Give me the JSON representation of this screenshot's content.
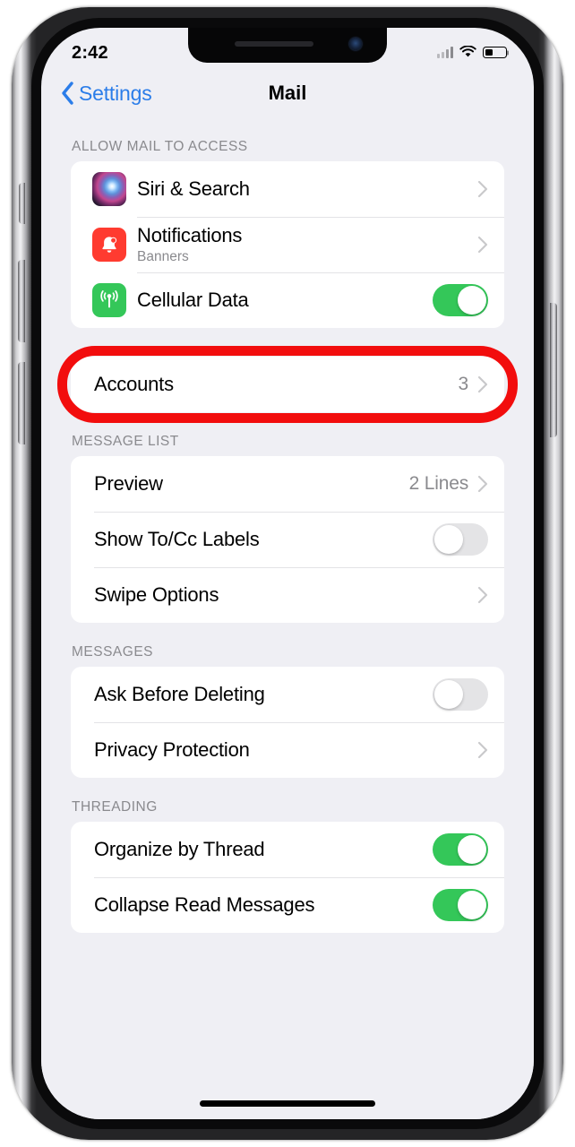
{
  "status_bar": {
    "time": "2:42",
    "signal_icon": "cellular-signal-icon",
    "wifi_icon": "wifi-icon",
    "battery_icon": "battery-icon",
    "battery_level_percent": 40
  },
  "nav_bar": {
    "back_label": "Settings",
    "back_icon": "chevron-left-icon",
    "title": "Mail"
  },
  "annotation": {
    "target": "Accounts",
    "shape": "rounded-rectangle-outline",
    "color": "#f20d0d"
  },
  "colors": {
    "background": "#efeff4",
    "card": "#ffffff",
    "tint_blue": "#2b7de9",
    "toggle_on_green": "#34c759",
    "toggle_off_gray": "#e4e4e6",
    "secondary_text": "#8a8a8e",
    "separator": "#e3e3e6"
  },
  "sections": [
    {
      "header": "ALLOW MAIL TO ACCESS",
      "rows": [
        {
          "label": "Siri & Search",
          "icon": "siri-icon",
          "icon_class": "icon-siri",
          "accessory": "chevron",
          "subtitle": "",
          "value": ""
        },
        {
          "label": "Notifications",
          "icon": "notifications-bell-icon",
          "icon_class": "icon-notifications",
          "accessory": "chevron",
          "subtitle": "Banners",
          "value": ""
        },
        {
          "label": "Cellular Data",
          "icon": "cellular-data-icon",
          "icon_class": "icon-cellular",
          "accessory": "toggle",
          "toggle_on": true,
          "subtitle": "",
          "value": ""
        }
      ]
    },
    {
      "header": "",
      "highlighted": true,
      "rows": [
        {
          "label": "Accounts",
          "icon": "",
          "accessory": "chevron",
          "value": "3",
          "subtitle": ""
        }
      ]
    },
    {
      "header": "MESSAGE LIST",
      "rows": [
        {
          "label": "Preview",
          "icon": "",
          "accessory": "chevron",
          "value": "2 Lines",
          "subtitle": ""
        },
        {
          "label": "Show To/Cc Labels",
          "icon": "",
          "accessory": "toggle",
          "toggle_on": false,
          "value": "",
          "subtitle": ""
        },
        {
          "label": "Swipe Options",
          "icon": "",
          "accessory": "chevron",
          "value": "",
          "subtitle": ""
        }
      ]
    },
    {
      "header": "MESSAGES",
      "rows": [
        {
          "label": "Ask Before Deleting",
          "icon": "",
          "accessory": "toggle",
          "toggle_on": false,
          "value": "",
          "subtitle": ""
        },
        {
          "label": "Privacy Protection",
          "icon": "",
          "accessory": "chevron",
          "value": "",
          "subtitle": ""
        }
      ]
    },
    {
      "header": "THREADING",
      "rows": [
        {
          "label": "Organize by Thread",
          "icon": "",
          "accessory": "toggle",
          "toggle_on": true,
          "value": "",
          "subtitle": ""
        },
        {
          "label": "Collapse Read Messages",
          "icon": "",
          "accessory": "toggle",
          "toggle_on": true,
          "value": "",
          "subtitle": ""
        }
      ]
    }
  ]
}
